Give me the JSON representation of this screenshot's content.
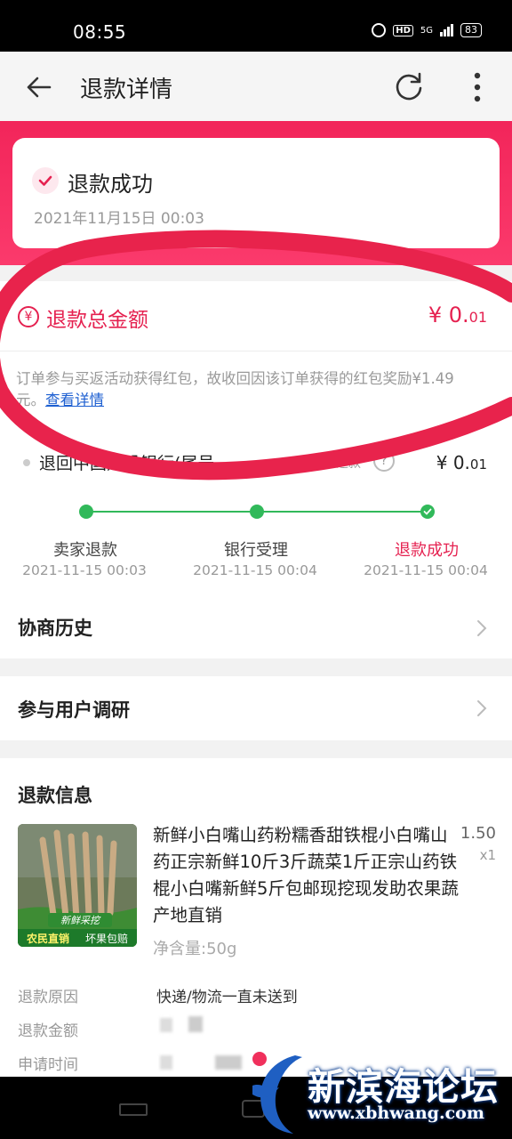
{
  "status_bar": {
    "time": "08:55",
    "hd": "HD",
    "network": "5G",
    "battery": "83"
  },
  "app_bar": {
    "title": "退款详情",
    "back_icon": "arrow-left-icon",
    "refresh_icon": "refresh-icon",
    "more_icon": "more-vert-icon"
  },
  "status_card": {
    "title": "退款成功",
    "date": "2021年11月15日 00:03"
  },
  "amount": {
    "label": "退款总金额",
    "currency": "¥",
    "value_int": "0.",
    "value_dec": "01",
    "note": "订单参与买返活动获得红包，故收回因该订单获得的红包奖励¥1.49元。",
    "note_link": "查看详情"
  },
  "bank": {
    "text": "退回中国建设银行(尾号",
    "sub": "未收到退款",
    "currency": "¥",
    "value_int": "0.",
    "value_dec": "01"
  },
  "progress": {
    "steps": [
      {
        "label": "卖家退款",
        "time": "2021-11-15 00:03"
      },
      {
        "label": "银行受理",
        "time": "2021-11-15 00:04"
      },
      {
        "label": "退款成功",
        "time": "2021-11-15 00:04"
      }
    ]
  },
  "rows": {
    "negotiation": "协商历史",
    "survey": "参与用户调研"
  },
  "refund_info": {
    "title": "退款信息",
    "product_name": "新鲜小白嘴山药粉糯香甜铁棍小白嘴山药正宗新鲜10斤3斤蔬菜1斤正宗山药铁棍小白嘴新鲜5斤包邮现挖现发助农果蔬产地直销",
    "price": "1.50",
    "qty": "x1",
    "spec": "净含量:50g",
    "image_badge_1": "新鲜采挖",
    "image_badge_2": "农民直销",
    "image_badge_3": "坏果包赔",
    "reason_label": "退款原因",
    "reason_value": "快递/物流一直未送到",
    "amount_label": "退款金额",
    "time_label": "申请时间"
  },
  "watermark": {
    "title": "新滨海论坛",
    "url": "www.xbhwang.com"
  },
  "colors": {
    "accent": "#e52150",
    "green": "#31b95a",
    "link": "#1d5fd1"
  }
}
